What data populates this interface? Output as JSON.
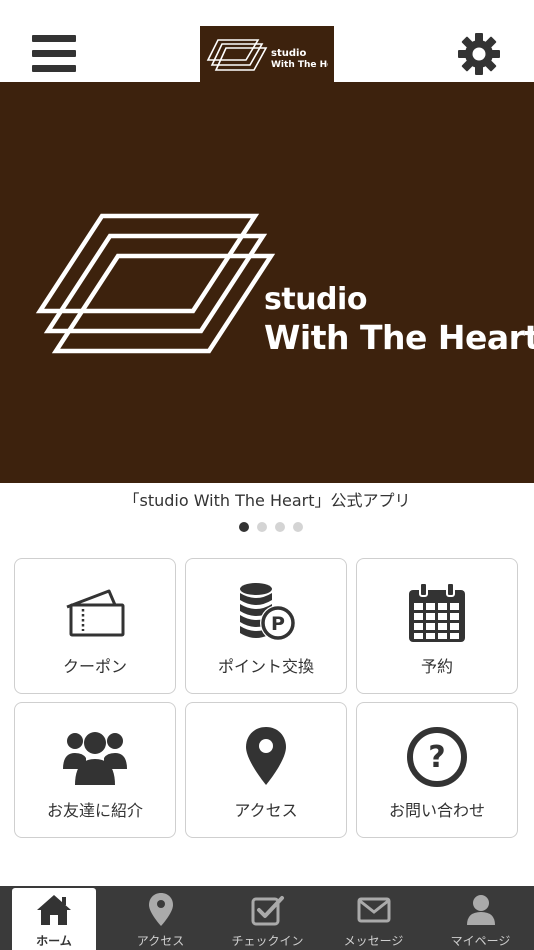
{
  "header": {
    "menu_icon": "hamburger-menu-icon",
    "settings_icon": "gear-icon",
    "logo_line1": "studio",
    "logo_line2": "With The Heart"
  },
  "hero": {
    "line1": "studio",
    "line2": "With The Heart",
    "caption": "「studio With The Heart」公式アプリ",
    "slide_count": 4,
    "active_slide": 1
  },
  "tiles": [
    {
      "label": "クーポン",
      "icon": "ticket-icon"
    },
    {
      "label": "ポイント交換",
      "icon": "coins-point-icon"
    },
    {
      "label": "予約",
      "icon": "calendar-icon"
    },
    {
      "label": "お友達に紹介",
      "icon": "group-icon"
    },
    {
      "label": "アクセス",
      "icon": "map-pin-icon"
    },
    {
      "label": "お問い合わせ",
      "icon": "question-icon"
    }
  ],
  "tabbar": {
    "items": [
      {
        "label": "ホーム",
        "icon": "home-icon",
        "active": true
      },
      {
        "label": "アクセス",
        "icon": "map-pin-icon",
        "active": false
      },
      {
        "label": "チェックイン",
        "icon": "checkbox-icon",
        "active": false
      },
      {
        "label": "メッセージ",
        "icon": "envelope-icon",
        "active": false
      },
      {
        "label": "マイページ",
        "icon": "person-icon",
        "active": false
      }
    ]
  },
  "colors": {
    "brand": "#3d220d",
    "tabbar": "#3a3a3a",
    "icon": "#333333"
  }
}
